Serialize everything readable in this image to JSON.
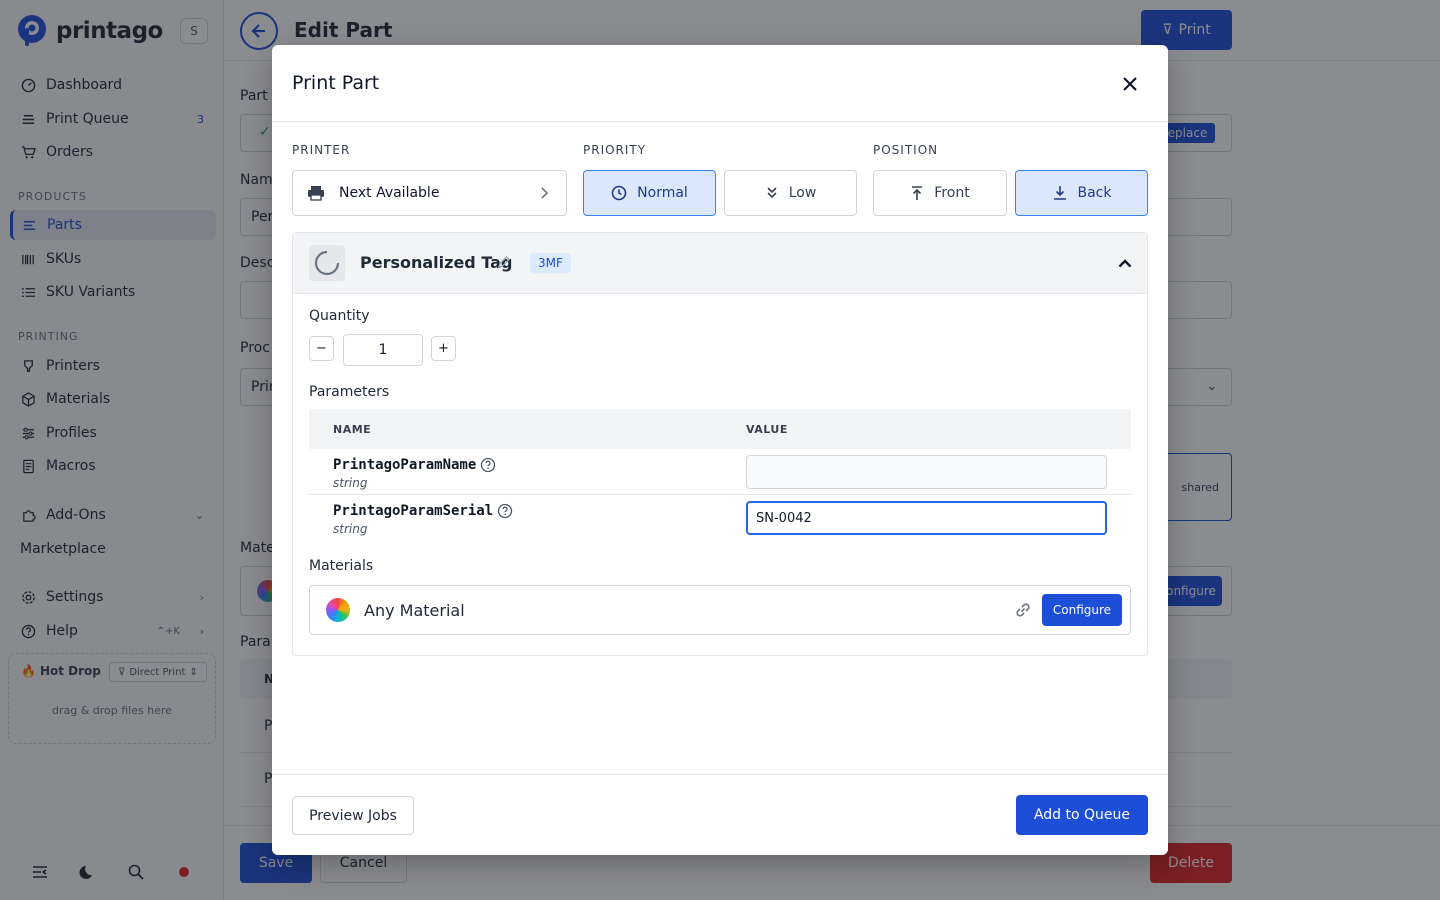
{
  "sidebar": {
    "brand": "printago",
    "org_initial": "S",
    "nav_main": [
      {
        "label": "Dashboard",
        "icon": "dashboard-icon"
      },
      {
        "label": "Print Queue",
        "icon": "queue-icon",
        "count": "3"
      },
      {
        "label": "Orders",
        "icon": "cart-icon"
      }
    ],
    "section_products": "PRODUCTS",
    "nav_products": [
      {
        "label": "Parts",
        "icon": "parts-icon",
        "active": true
      },
      {
        "label": "SKUs",
        "icon": "barcode-icon"
      },
      {
        "label": "SKU Variants",
        "icon": "list-icon"
      }
    ],
    "section_printing": "PRINTING",
    "nav_printing": [
      {
        "label": "Printers",
        "icon": "printer-icon"
      },
      {
        "label": "Materials",
        "icon": "cube-icon"
      },
      {
        "label": "Profiles",
        "icon": "sliders-icon"
      },
      {
        "label": "Macros",
        "icon": "document-icon"
      }
    ],
    "addons": "Add-Ons",
    "marketplace": "Marketplace",
    "settings": "Settings",
    "help": "Help",
    "help_shortcut": "⌃+K",
    "hotdrop": {
      "title": "Hot Drop",
      "mode": "Direct Print",
      "hint": "drag & drop files here"
    }
  },
  "page": {
    "title": "Edit Part",
    "print_button": "Print",
    "save": "Save",
    "cancel": "Cancel",
    "delete": "Delete",
    "replace": "eplace",
    "shared": "shared",
    "configure": "onfigure",
    "labels": {
      "part": "Part f",
      "name": "Nam",
      "description": "Desc",
      "process": "Proc",
      "materials": "Mate",
      "params": "Para"
    },
    "field_text": {
      "name": "Per",
      "process": "Prin"
    },
    "table_head": "N",
    "rows": [
      "P",
      "P"
    ]
  },
  "modal": {
    "title": "Print Part",
    "printer_label": "PRINTER",
    "printer_value": "Next Available",
    "priority_label": "PRIORITY",
    "priority_options": [
      "Normal",
      "Low"
    ],
    "priority_selected": "Normal",
    "position_label": "POSITION",
    "position_options": [
      "Front",
      "Back"
    ],
    "position_selected": "Back",
    "part": {
      "name": "Personalized Tag",
      "badge": "3MF",
      "quantity_label": "Quantity",
      "quantity": "1",
      "minus": "−",
      "plus": "+",
      "parameters_label": "Parameters",
      "table_headers": {
        "name": "NAME",
        "value": "VALUE"
      },
      "parameters": [
        {
          "name": "PrintagoParamName",
          "type": "string",
          "value": ""
        },
        {
          "name": "PrintagoParamSerial",
          "type": "string",
          "value": "SN-0042"
        }
      ],
      "materials_label": "Materials",
      "material": {
        "name": "Any Material",
        "configure": "Configure"
      }
    },
    "preview_jobs": "Preview Jobs",
    "add_to_queue": "Add to Queue"
  },
  "colors": {
    "accent": "#1d4ed8",
    "selected_bg": "#dbe7fd",
    "danger": "#dc2626"
  }
}
